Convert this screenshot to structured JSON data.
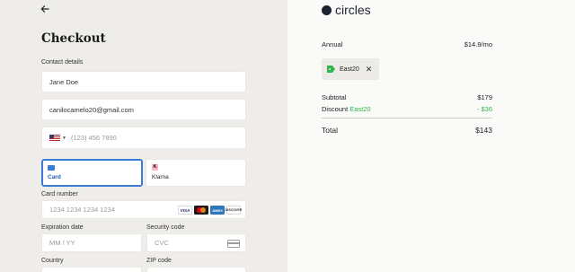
{
  "checkout": {
    "back_icon": "arrow-left-icon",
    "title": "Checkout",
    "contact_label": "Contact details",
    "name_value": "Jane Doe",
    "email_value": "canilocamelo20@gmail.com",
    "phone_country": "us-flag-icon",
    "phone_placeholder": "(123) 456 7890",
    "payment_methods": [
      {
        "label": "Card",
        "icon": "credit-card-icon",
        "selected": true
      },
      {
        "label": "Klarna",
        "icon_text": "K",
        "icon": "klarna-icon",
        "selected": false
      }
    ],
    "card_number_label": "Card number",
    "card_number_placeholder": "1234 1234 1234 1234",
    "card_brands": [
      {
        "icon": "visa-icon",
        "text": "VISA"
      },
      {
        "icon": "mastercard-icon",
        "text": ""
      },
      {
        "icon": "amex-icon",
        "text": "AMEX"
      },
      {
        "icon": "discover-icon",
        "text": "DISCOVER"
      }
    ],
    "expiration_label": "Expiration date",
    "expiration_placeholder": "MM / YY",
    "security_label": "Security code",
    "security_placeholder": "CVC",
    "cvc_icon": "cvc-card-icon",
    "country_label": "Country",
    "zip_label": "ZIP code"
  },
  "summary": {
    "logo_text": "circles",
    "plan_label": "Annual",
    "plan_price": "$14.9/mo",
    "coupon_code": "East20",
    "coupon_icon": "tag-icon",
    "coupon_remove_icon": "close-icon",
    "subtotal_label": "Subtotal",
    "subtotal_value": "$179",
    "discount_label": "Discount",
    "discount_code": "East20",
    "discount_value": "- $36",
    "total_label": "Total",
    "total_value": "$143"
  },
  "colors": {
    "left_bg": "#efedea",
    "accent_blue": "#3a7bd5",
    "discount_green": "#2fb34a"
  }
}
